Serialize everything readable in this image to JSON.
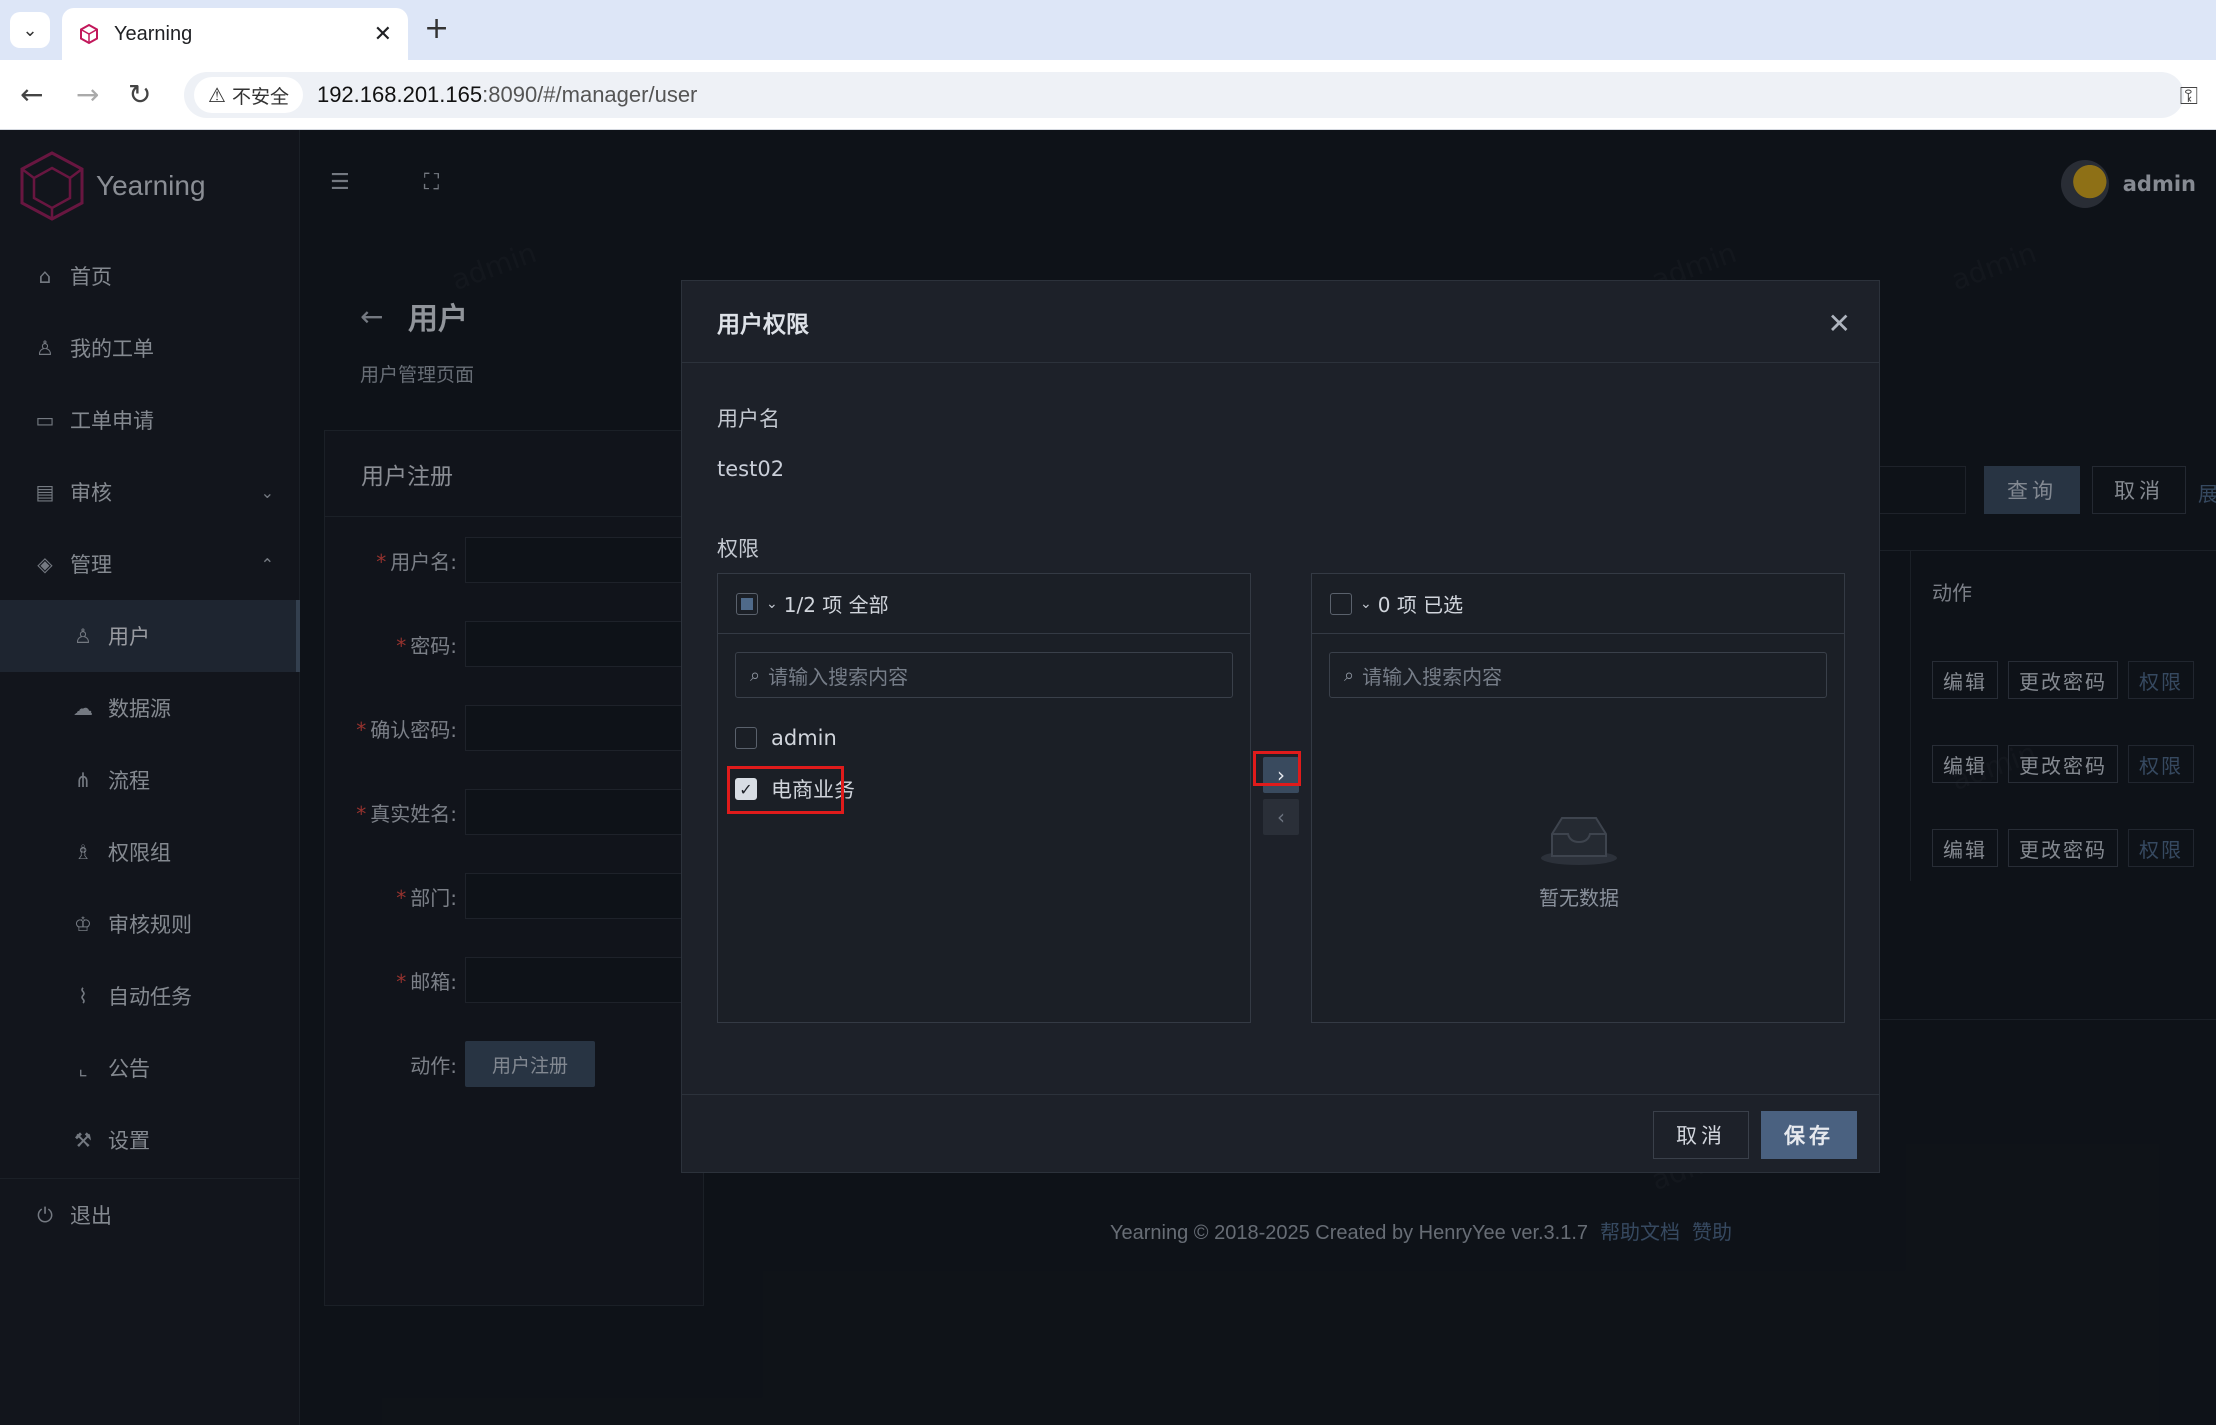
{
  "browser": {
    "tab_title": "Yearning",
    "security_label": "不安全",
    "url_host": "192.168.201.165",
    "url_path": ":8090/#/manager/user"
  },
  "app": {
    "logo_text": "Yearning",
    "username": "admin",
    "sidebar": {
      "items": [
        {
          "label": "首页",
          "icon": "home-icon"
        },
        {
          "label": "我的工单",
          "icon": "user-icon"
        },
        {
          "label": "工单申请",
          "icon": "monitor-icon"
        },
        {
          "label": "审核",
          "icon": "audit-icon"
        },
        {
          "label": "管理",
          "icon": "manage-icon"
        },
        {
          "label": "用户",
          "icon": "user-icon"
        },
        {
          "label": "数据源",
          "icon": "cloud-icon"
        },
        {
          "label": "流程",
          "icon": "flow-icon"
        },
        {
          "label": "权限组",
          "icon": "group-icon"
        },
        {
          "label": "审核规则",
          "icon": "crown-icon"
        },
        {
          "label": "自动任务",
          "icon": "paperclip-icon"
        },
        {
          "label": "公告",
          "icon": "chart-icon"
        },
        {
          "label": "设置",
          "icon": "wrench-icon"
        },
        {
          "label": "退出",
          "icon": "logout-icon"
        }
      ]
    },
    "page": {
      "title": "用户",
      "subtitle": "用户管理页面"
    },
    "register": {
      "card_title": "用户注册",
      "fields": [
        "用户名:",
        "密码:",
        "确认密码:",
        "真实姓名:",
        "部门:",
        "邮箱:"
      ],
      "action_label": "动作:",
      "submit_label": "用户注册"
    },
    "table": {
      "query_label": "查询",
      "cancel_label": "取消",
      "trunc_link": "展",
      "action_header": "动作",
      "row_buttons": {
        "edit": "编辑",
        "change_password": "更改密码",
        "permission": "权限"
      }
    },
    "footer": {
      "text": "Yearning © 2018-2025 Created by HenryYee ver.3.1.7",
      "help_link": "帮助文档",
      "sponsor_link": "赞助"
    },
    "watermark": "admin"
  },
  "modal": {
    "title": "用户权限",
    "username_label": "用户名",
    "username_value": "test02",
    "permission_label": "权限",
    "left_panel": {
      "header": "1/2 项 全部",
      "search_placeholder": "请输入搜索内容",
      "items": [
        {
          "label": "admin",
          "checked": false
        },
        {
          "label": "电商业务",
          "checked": true
        }
      ]
    },
    "right_panel": {
      "header": "0 项 已选",
      "search_placeholder": "请输入搜索内容",
      "empty_text": "暂无数据"
    },
    "cancel_label": "取消",
    "save_label": "保存"
  },
  "colors": {
    "highlight": "#e01b1b",
    "primary_button": "#4a6180",
    "background": "#12161d"
  }
}
